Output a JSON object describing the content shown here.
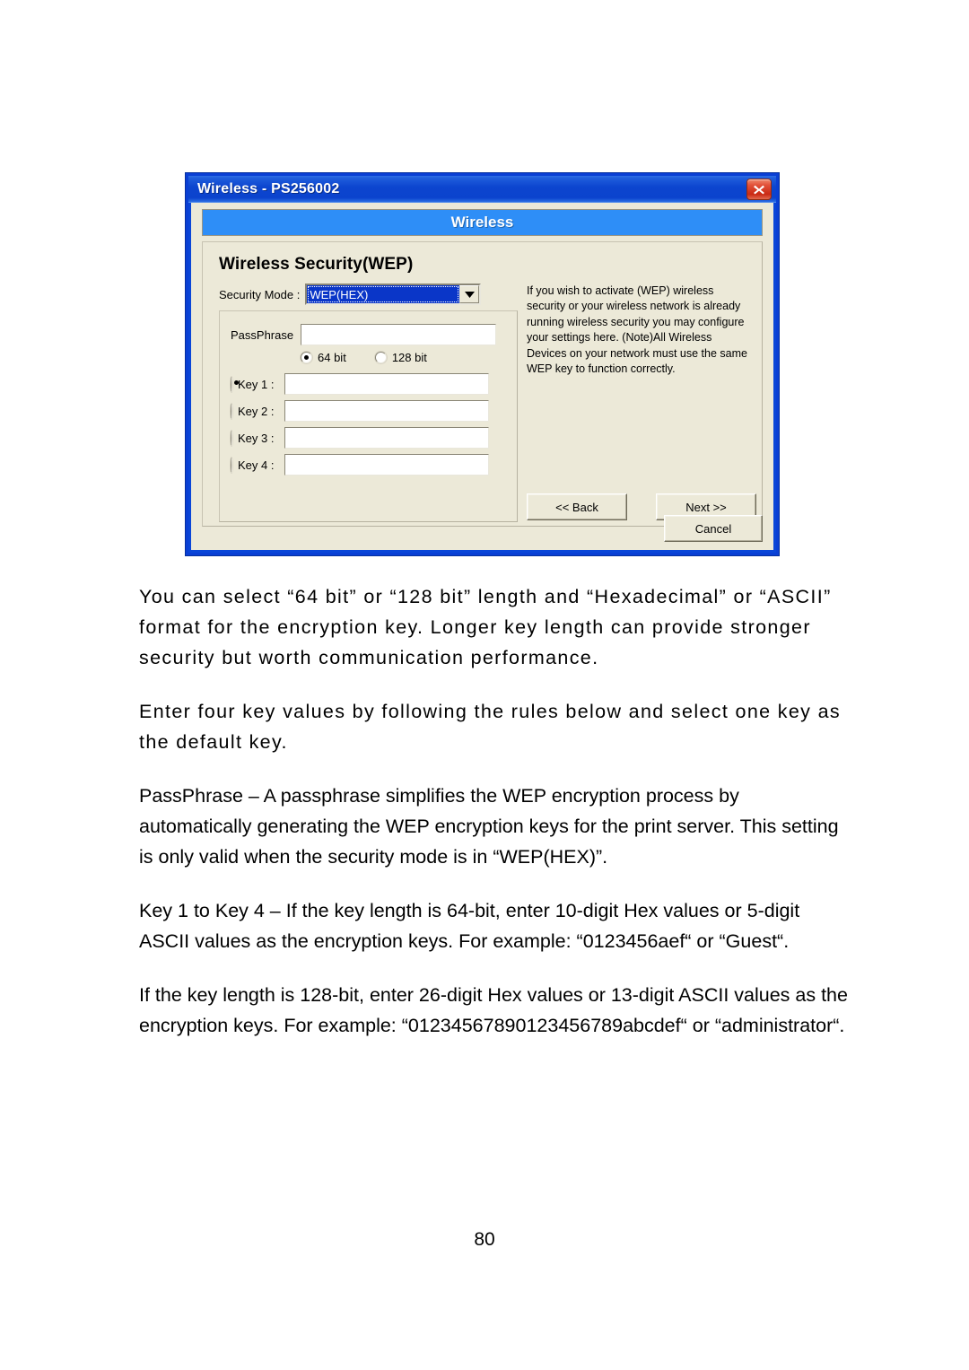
{
  "dialog": {
    "title": "Wireless - PS256002",
    "close_icon": "close-icon",
    "banner": "Wireless",
    "section_title": "Wireless Security(WEP)",
    "security_mode": {
      "label": "Security Mode :",
      "value": "WEP(HEX)",
      "arrow_icon": "chevron-down-icon"
    },
    "passphrase": {
      "label": "PassPhrase",
      "value": "",
      "placeholder": ""
    },
    "key_length": {
      "options": [
        {
          "label": "64 bit",
          "selected": true
        },
        {
          "label": "128 bit",
          "selected": false
        }
      ]
    },
    "keys": [
      {
        "label": "Key 1 :",
        "value": "",
        "selected": true
      },
      {
        "label": "Key 2 :",
        "value": "",
        "selected": false
      },
      {
        "label": "Key 3 :",
        "value": "",
        "selected": false
      },
      {
        "label": "Key 4 :",
        "value": "",
        "selected": false
      }
    ],
    "help_text": "If you wish to activate (WEP) wireless security or your wireless network is already running wireless security you may configure your settings here. (Note)All Wireless Devices on your network must use the same WEP key to function correctly.",
    "buttons": {
      "back": "<< Back",
      "next": "Next >>",
      "cancel": "Cancel"
    },
    "colors": {
      "titlebar_blue": "#0a46d8",
      "banner_blue": "#2e8ef7",
      "face": "#ece9d8",
      "selection_blue": "#0a36c8",
      "close_red": "#c92a14"
    }
  },
  "document": {
    "paragraphs": [
      "You can select “64 bit” or “128 bit” length and “Hexadecimal” or “ASCII” format for the encryption key. Longer key length can provide stronger security but worth communication performance.",
      "Enter four key values by following the rules below and select one key as the default key.",
      "PassPhrase – A passphrase simplifies the WEP encryption process by automatically generating the WEP encryption keys for the print server. This setting is only valid when the security mode is in “WEP(HEX)”.",
      "Key 1 to Key 4 – If the key length is 64-bit, enter 10-digit Hex values or 5-digit ASCII values as the encryption keys. For example: “0123456aef“ or “Guest“.",
      "If the key length is 128-bit, enter 26-digit Hex values or 13-digit ASCII values as the encryption keys. For example: “01234567890123456789abcdef“ or “administrator“."
    ],
    "page_number": "80"
  }
}
